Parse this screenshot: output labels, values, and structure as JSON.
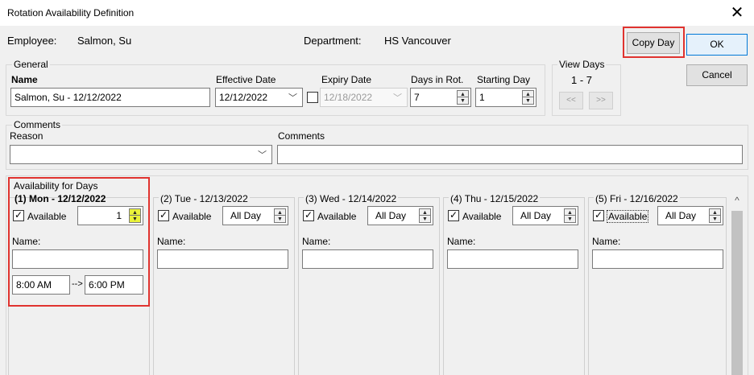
{
  "window": {
    "title": "Rotation Availability Definition",
    "close_glyph": "✕"
  },
  "employee_bar": {
    "employee_label": "Employee:",
    "employee_value": "Salmon, Su",
    "department_label": "Department:",
    "department_value": "HS Vancouver"
  },
  "buttons": {
    "copy_day": "Copy Day",
    "ok": "OK",
    "cancel": "Cancel"
  },
  "general": {
    "legend": "General",
    "name_label": "Name",
    "name_value": "Salmon, Su - 12/12/2022",
    "effective_date_label": "Effective Date",
    "effective_date_value": "12/12/2022",
    "expiry_date_label": "Expiry Date",
    "expiry_date_value": "12/18/2022",
    "days_in_rot_label": "Days in Rot.",
    "days_in_rot_value": "7",
    "starting_day_label": "Starting Day",
    "starting_day_value": "1"
  },
  "view_days": {
    "label": "View Days",
    "range": "1 - 7",
    "prev": "<<",
    "next": ">>"
  },
  "comments": {
    "legend": "Comments",
    "reason_label": "Reason",
    "reason_value": "",
    "comments_label": "Comments",
    "comments_value": ""
  },
  "availability": {
    "legend": "Availability for Days",
    "days": [
      {
        "title": "(1) Mon - 12/12/2022",
        "available_label": "Available",
        "spin_value": "1",
        "name_label": "Name:",
        "name_value": "",
        "start_time": "8:00 AM",
        "arrow": "-->",
        "end_time": "6:00 PM"
      },
      {
        "title": "(2) Tue - 12/13/2022",
        "available_label": "Available",
        "spin_value": "All Day",
        "name_label": "Name:",
        "name_value": ""
      },
      {
        "title": "(3) Wed - 12/14/2022",
        "available_label": "Available",
        "spin_value": "All Day",
        "name_label": "Name:",
        "name_value": ""
      },
      {
        "title": "(4) Thu - 12/15/2022",
        "available_label": "Available",
        "spin_value": "All Day",
        "name_label": "Name:",
        "name_value": ""
      },
      {
        "title": "(5) Fri - 12/16/2022",
        "available_label": "Available",
        "spin_value": "All Day",
        "name_label": "Name:",
        "name_value": ""
      }
    ]
  },
  "glyphs": {
    "check": "✓",
    "chevron_down": "﹀",
    "spin_up": "▲",
    "spin_down": "▼",
    "scroll_up": "^"
  },
  "colors": {
    "highlight_red": "#e0332f",
    "ok_border": "#0078d7",
    "spin_highlight": "#e9f23a"
  }
}
